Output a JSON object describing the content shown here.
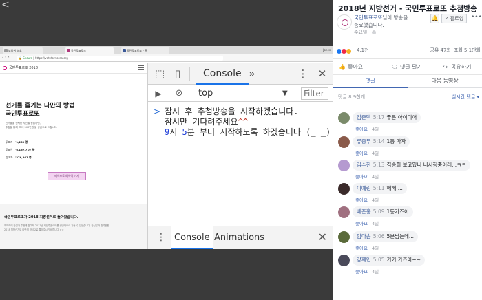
{
  "video": {
    "back_glyph": "<",
    "browser": {
      "tabs": [
        "보험위 봉요",
        "국민투표로또",
        "국민투표로또 - 홈"
      ],
      "user": "Jones",
      "url_secure": "Secure",
      "url": "https://votefornorea.org"
    },
    "webpage": {
      "brand": "국민투표로또 2018",
      "hero_title": "선거를 즐기는 나만의 방법",
      "hero_sub": "국민투표로또",
      "hero_sub_highlight": "또",
      "para": [
        "선거들을 선택한 사진을 응답하면,",
        "추첨을 통해 '최대 500만원'을 상금으로 드립니다."
      ],
      "stats": [
        {
          "label": "투표자 : ",
          "value": "'1,239 명'"
        },
        {
          "label": "투표인 : ",
          "value": "'6,167,719 원'"
        },
        {
          "label": "참여자 : ",
          "value": "'276,261 명'"
        }
      ],
      "button": "메이스로 예약이 가기",
      "foot_title": "국민투표로또가 2018 지방선거로 돌아왔습니다.",
      "foot_p": [
        "예약해에 참실과 투표에 참여하 2017년 제인투표로또를 성공적으로 가동 수 있었습니다. 참실분과 참여한원 ",
        "2018 지방선거도 나만의 방식으로 즐겨주시기 바랍니다 ㅎㅎ"
      ]
    },
    "devtools": {
      "tab_console": "Console",
      "tab_more": "»",
      "context": "top",
      "filter_placeholder": "Filter",
      "log_line1": "잠시 후 추첨방송을 시작하겠습니다.",
      "log_line2_prefix": "잠시만 기다려주세요",
      "log_line2_emoji": "^^",
      "log_line3_num1": "9",
      "log_line3_mid": "시 ",
      "log_line3_num2": "5",
      "log_line3_rest": "분 부터 시작하도록 하겠습니다 (_ _)",
      "drawer_tabs": [
        "Console",
        "Animations"
      ]
    }
  },
  "fb": {
    "title": "2018년 지방선거 - 국민투표로또 추첨방송",
    "channel": "국민투표로또",
    "line1_suffix": "님이 방송을",
    "line2": "종료했습니다.",
    "line3": "수요일 · ",
    "follow_label": "✓ 팔로잉",
    "reaction_count": "4.1천",
    "stats": [
      "공유 47회",
      "조회 5.1만회"
    ],
    "actions": [
      "좋아요",
      "댓글 달기",
      "공유하기"
    ],
    "tabs": [
      "댓글",
      "다음 동영상"
    ],
    "comment_count": "댓글 8.9천개",
    "sort": "실시간 댓글 ▾",
    "like_label": "좋아요",
    "comments": [
      {
        "author": "김준택",
        "time": "5:17",
        "text": "좋은 아이디어",
        "age": "4일",
        "color": "#7a8a6a"
      },
      {
        "author": "류종무",
        "time": "5:14",
        "text": "1등 가자",
        "age": "4일",
        "color": "#8a5a4a"
      },
      {
        "author": "김수찬",
        "time": "5:13",
        "text": "김승희 보고있니 니시청중이래...ㅋㅋ",
        "age": "4일",
        "color": "#b59ad0"
      },
      {
        "author": "이예린",
        "time": "5:11",
        "text": "헤헤 ...",
        "age": "4일",
        "color": "#3a2a2a"
      },
      {
        "author": "배준홍",
        "time": "5:09",
        "text": "1등가즈아",
        "age": "4일",
        "color": "#a07080"
      },
      {
        "author": "임다솜",
        "time": "5:06",
        "text": "5분남는데...",
        "age": "4일",
        "color": "#5a6a3a"
      },
      {
        "author": "강재민",
        "time": "5:05",
        "text": "기기 가즈아~~",
        "age": "4일",
        "color": "#4a4a5a"
      }
    ],
    "colors": {
      "link": "#385898",
      "accent": "#4267b2"
    }
  }
}
